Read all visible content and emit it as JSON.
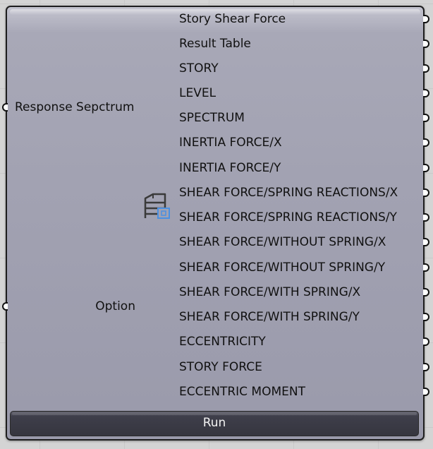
{
  "component": {
    "inputs": [
      {
        "label": "Response Sepctrum"
      },
      {
        "label": "Option"
      }
    ],
    "outputs": [
      {
        "label": "Story Shear Force"
      },
      {
        "label": "Result Table"
      },
      {
        "label": "STORY"
      },
      {
        "label": "LEVEL"
      },
      {
        "label": "SPECTRUM"
      },
      {
        "label": "INERTIA FORCE/X"
      },
      {
        "label": "INERTIA FORCE/Y"
      },
      {
        "label": "SHEAR FORCE/SPRING REACTIONS/X"
      },
      {
        "label": "SHEAR FORCE/SPRING REACTIONS/Y"
      },
      {
        "label": "SHEAR FORCE/WITHOUT SPRING/X"
      },
      {
        "label": "SHEAR FORCE/WITHOUT SPRING/Y"
      },
      {
        "label": "SHEAR FORCE/WITH SPRING/X"
      },
      {
        "label": "SHEAR FORCE/WITH SPRING/Y"
      },
      {
        "label": "ECCENTRICITY"
      },
      {
        "label": "STORY FORCE"
      },
      {
        "label": "ECCENTRIC MOMENT"
      }
    ],
    "icon": "story-shear-table-icon",
    "run_button": {
      "label": "Run"
    }
  },
  "colors": {
    "component_body": "#a2a2b2",
    "run_bar": "#36363f",
    "icon_accent": "#4a90e2",
    "canvas": "#d4d4d4"
  }
}
